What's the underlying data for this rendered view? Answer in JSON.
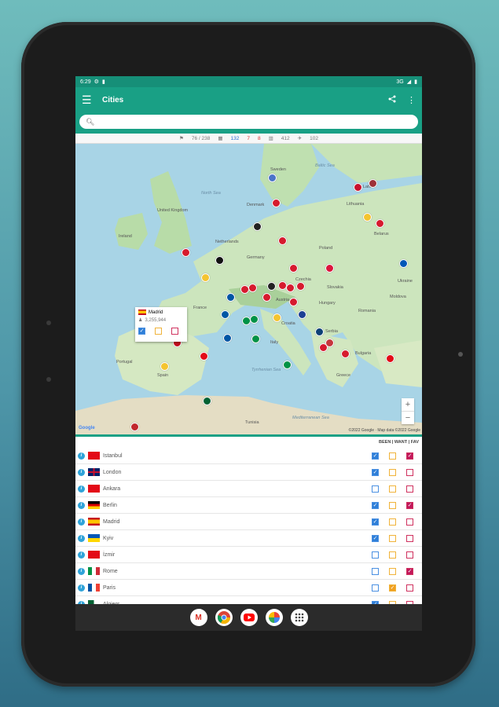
{
  "statusbar": {
    "time": "6:29",
    "network": "3G"
  },
  "toolbar": {
    "title": "Cities"
  },
  "search": {
    "placeholder": ""
  },
  "stats": {
    "flags": "76 / 238",
    "cities_a": "132",
    "cities_b": "7",
    "cities_c": "8",
    "buildings": "412",
    "flights": "102"
  },
  "map": {
    "labels": {
      "sweden": "Sweden",
      "baltic": "Baltic Sea",
      "north_sea": "North Sea",
      "latvia": "Latvia",
      "lithuania": "Lithuania",
      "denmark": "Denmark",
      "uk": "United Kingdom",
      "ireland": "Ireland",
      "belarus": "Belarus",
      "netherlands": "Netherlands",
      "germany": "Germany",
      "poland": "Poland",
      "czechia": "Czechia",
      "slovakia": "Slovakia",
      "ukraine": "Ukraine",
      "france": "France",
      "austria": "Austria",
      "hungary": "Hungary",
      "moldova": "Moldova",
      "romania": "Romania",
      "croatia": "Croatia",
      "serbia": "Serbia",
      "italy": "Italy",
      "bulgaria": "Bulgaria",
      "portugal": "Portugal",
      "spain": "Spain",
      "tyrrhenian": "Tyrrhenian Sea",
      "greece": "Greece",
      "mediterranean": "Mediterranean Sea",
      "tunisia": "Tunisia"
    },
    "popup": {
      "city": "Madrid",
      "population": "3,255,944"
    },
    "attribution": "©2022 Google · Map data ©2022 Google",
    "google": "Google",
    "zoom_in": "+",
    "zoom_out": "−"
  },
  "list_header": "BEEN | WANT | FAV",
  "cities": [
    {
      "name": "Istanbul",
      "been": true,
      "want": false,
      "fav": true
    },
    {
      "name": "London",
      "been": true,
      "want": false,
      "fav": false
    },
    {
      "name": "Ankara",
      "been": false,
      "want": false,
      "fav": false
    },
    {
      "name": "Berlin",
      "been": true,
      "want": false,
      "fav": true
    },
    {
      "name": "Madrid",
      "been": true,
      "want": false,
      "fav": false
    },
    {
      "name": "Kyiv",
      "been": true,
      "want": false,
      "fav": false
    },
    {
      "name": "İzmir",
      "been": false,
      "want": false,
      "fav": false
    },
    {
      "name": "Rome",
      "been": false,
      "want": false,
      "fav": true
    },
    {
      "name": "Paris",
      "been": false,
      "want": true,
      "fav": false
    },
    {
      "name": "Algiers",
      "been": true,
      "want": false,
      "fav": false
    }
  ],
  "colors": {
    "accent": "#19a085",
    "been": "#2f7fd8",
    "want": "#f0a020",
    "fav": "#c2185b"
  },
  "icons": {
    "menu": "menu-icon",
    "share": "share-icon",
    "more": "more-vert-icon",
    "search": "search-icon",
    "info": "info-icon"
  },
  "dock": [
    "Gmail",
    "Chrome",
    "YouTube",
    "Photos",
    "Apps"
  ]
}
